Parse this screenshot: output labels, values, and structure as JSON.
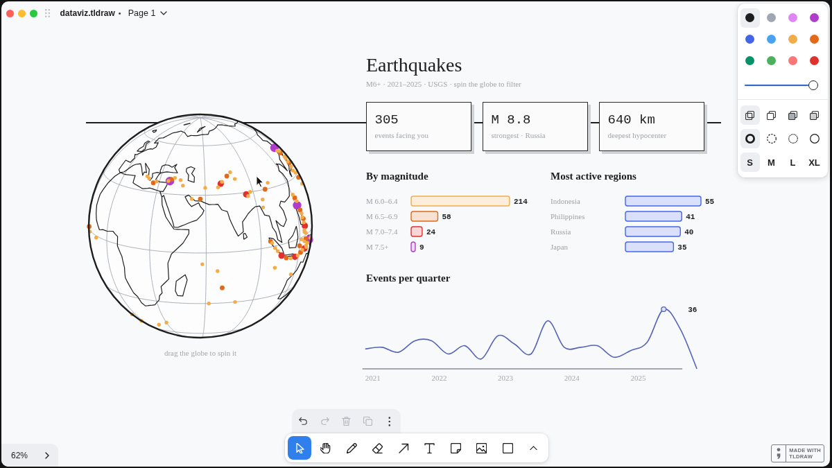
{
  "window": {
    "file_name": "dataviz.tldraw",
    "status_mark": "•",
    "page_menu": {
      "label": "Page 1"
    }
  },
  "style_panel": {
    "colors": [
      {
        "color": "#1d1d1d",
        "selected": true
      },
      {
        "color": "#9fa8b2",
        "selected": false
      },
      {
        "color": "#e085f4",
        "selected": false
      },
      {
        "color": "#ae3ec9",
        "selected": false
      },
      {
        "color": "#4465e9",
        "selected": false
      },
      {
        "color": "#4ba1f1",
        "selected": false
      },
      {
        "color": "#f1ac4b",
        "selected": false
      },
      {
        "color": "#e16919",
        "selected": false
      },
      {
        "color": "#099268",
        "selected": false
      },
      {
        "color": "#4cb05e",
        "selected": false
      },
      {
        "color": "#f87777",
        "selected": false
      },
      {
        "color": "#e03131",
        "selected": false
      }
    ],
    "opacity": {
      "level": 1
    },
    "fills": [
      {
        "kind": "none",
        "selected": true
      },
      {
        "kind": "semi",
        "selected": false
      },
      {
        "kind": "solid",
        "selected": false
      },
      {
        "kind": "pattern",
        "selected": false
      }
    ],
    "dashes": [
      {
        "kind": "draw",
        "selected": true
      },
      {
        "kind": "dashed",
        "selected": false
      },
      {
        "kind": "dotted",
        "selected": false
      },
      {
        "kind": "solid",
        "selected": false
      }
    ],
    "sizes": [
      {
        "label": "S",
        "selected": true
      },
      {
        "label": "M",
        "selected": false
      },
      {
        "label": "L",
        "selected": false
      },
      {
        "label": "XL",
        "selected": false
      }
    ]
  },
  "globe": {
    "caption": "drag the globe to spin it"
  },
  "dashboard": {
    "title": "Earthquakes",
    "subtitle": "M6+ · 2021–2025 · USGS · spin the globe to filter",
    "stats": [
      {
        "value": "305",
        "label": "events facing you"
      },
      {
        "value": "M 8.8",
        "label": "strongest · Russia"
      },
      {
        "value": "640 km",
        "label": "deepest hypocenter"
      }
    ],
    "magnitude_chart": {
      "chart_data": {
        "type": "bar",
        "orientation": "horizontal",
        "title": "By magnitude",
        "categories": [
          "M 6.0–6.4",
          "M 6.5–6.9",
          "M 7.0–7.4",
          "M 7.5+"
        ],
        "values": [
          214,
          58,
          24,
          9
        ],
        "colors": [
          "#f1ac4b",
          "#e16919",
          "#e03131",
          "#ae3ec9"
        ],
        "data_labels": true
      }
    },
    "regions_chart": {
      "chart_data": {
        "type": "bar",
        "orientation": "horizontal",
        "title": "Most active regions",
        "categories": [
          "Indonesia",
          "Philippines",
          "Russia",
          "Japan"
        ],
        "values": [
          55,
          41,
          40,
          35
        ],
        "color": "#4465e9",
        "data_labels": true
      }
    },
    "quarter_chart": {
      "title": "Events per quarter",
      "year_labels": [
        "2021",
        "2022",
        "2023",
        "2024",
        "2025"
      ],
      "peak_label": "36"
    }
  },
  "toolbar": {
    "actions": [
      {
        "kind": "undo",
        "disabled": false
      },
      {
        "kind": "redo",
        "disabled": true
      },
      {
        "kind": "delete",
        "disabled": true
      },
      {
        "kind": "duplicate",
        "disabled": true
      },
      {
        "kind": "more",
        "disabled": false
      }
    ],
    "tools": [
      {
        "kind": "select",
        "selected": true
      },
      {
        "kind": "hand",
        "selected": false
      },
      {
        "kind": "draw",
        "selected": false
      },
      {
        "kind": "eraser",
        "selected": false
      },
      {
        "kind": "arrow",
        "selected": false
      },
      {
        "kind": "text",
        "selected": false
      },
      {
        "kind": "note",
        "selected": false
      },
      {
        "kind": "image",
        "selected": false
      },
      {
        "kind": "rectangle",
        "selected": false
      },
      {
        "kind": "more",
        "selected": false
      }
    ]
  },
  "zoom_menu": {
    "label": "62%"
  },
  "badge": {
    "lines": [
      "MADE WITH",
      "TLDRAW"
    ]
  }
}
